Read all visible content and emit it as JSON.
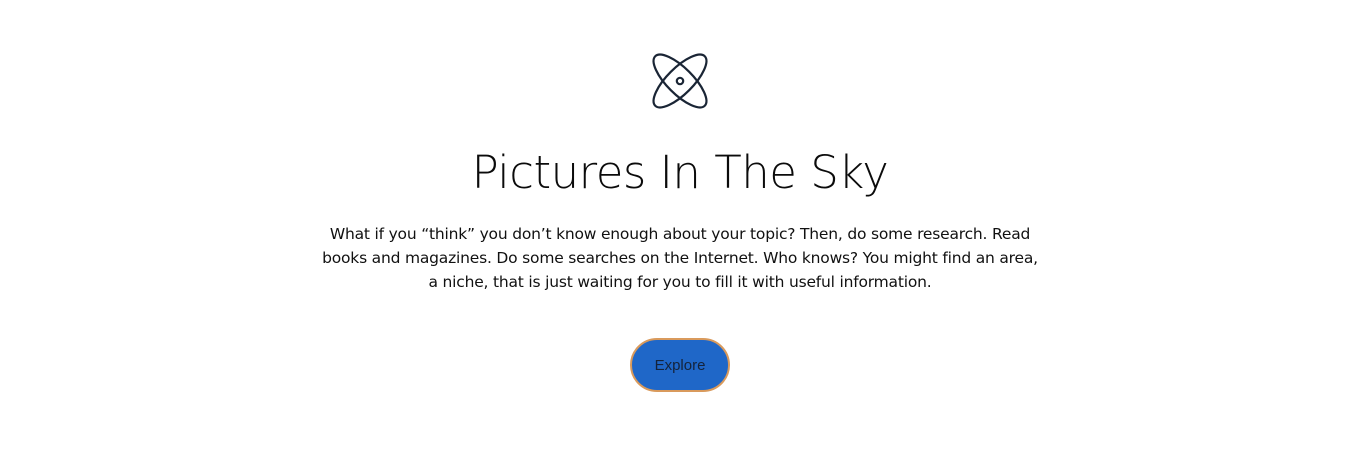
{
  "hero": {
    "icon": "atom-icon",
    "title": "Pictures In The Sky",
    "description": "What if you “think” you don’t know enough about your topic? Then, do some research. Read books and magazines. Do some searches on the Internet. Who knows? You might find an area, a niche, that is just waiting for you to fill it with useful information.",
    "button_label": "Explore"
  },
  "colors": {
    "text": "#0b0b0b",
    "icon": "#1a2535",
    "button_bg": "#1f67c8",
    "button_border": "#d99a5c",
    "button_text": "#14233b",
    "background": "#ffffff"
  }
}
